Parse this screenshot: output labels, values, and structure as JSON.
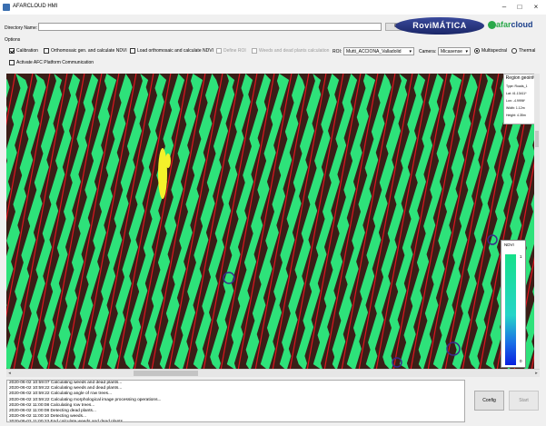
{
  "window": {
    "title": "AFARCLOUD HMI",
    "minimize_icon": "minimize-icon",
    "maximize_icon": "maximize-icon",
    "close_icon": "close-icon"
  },
  "directory": {
    "label": "Directory Name:",
    "value": "",
    "open_label": "Open"
  },
  "logos": {
    "rovimatica": "RoviMÁTICA",
    "afarcloud_prefix": "afar",
    "afarcloud_suffix": "cloud"
  },
  "options": {
    "label": "Options",
    "calibration": {
      "label": "Calibration",
      "checked": true
    },
    "orthomosaic_ndvi": {
      "label": "Orthomosaic gen. and calculate NDVI",
      "checked": false
    },
    "load_orthomosaic": {
      "label": "Load orthomosaic and calculate NDVI",
      "checked": false
    },
    "define_roi": {
      "label": "Define ROI",
      "checked": false,
      "disabled": true
    },
    "weeds_dead": {
      "label": "Weeds and dead plants calculation",
      "checked": false,
      "disabled": true
    },
    "roi_label": "ROI:",
    "roi_value": "Mutti_ACCIONA_Valladolid",
    "camera_label": "Camera:",
    "camera_value": "Micasense",
    "multispectral": {
      "label": "Multispectral",
      "selected": true
    },
    "thermal": {
      "label": "Thermal",
      "selected": false
    },
    "activate_afc": {
      "label": "Activate AFC Platform Communication",
      "checked": false
    }
  },
  "geoinfo": {
    "title": "Region geoinfo",
    "type": "Type: Roads_1",
    "lat": "Lat: 41.13411º",
    "lon": "Lon: -4.9996º",
    "width": "Width: 1.12m",
    "height": "Height: 4.35m"
  },
  "ndvi_legend": {
    "title": "NDVI",
    "max": "1",
    "min": "0",
    "colors": {
      "high": "#16e08a",
      "mid": "#25d4c8",
      "low": "#0a1fe0"
    }
  },
  "field_colors": {
    "soil": "#3a1e17",
    "crop": "#2ee27a",
    "row_line": "#e0151f",
    "weed": "#f4f12a",
    "dead": "#3a2a8a"
  },
  "log": {
    "lines": [
      "2020-06-02 10:59:07 Calculating weeds and dead plants...",
      "2020-06-02 10:59:22 Calculating weeds and dead plants...",
      "2020-06-02 10:59:22 Calculating angle of row trees...",
      "2020-06-02 10:59:22 Calculating morphological image processing operations...",
      "2020-06-02 11:00:08 Calculating row trees...",
      "2020-06-02 11:00:08 Detecting dead plants...",
      "2020-06-02 11:00:10 Detecting weeds...",
      "2020-06-02 11:00:23 End calculate weeds and dead plants..."
    ]
  },
  "buttons": {
    "config": "Config",
    "start": "Start"
  }
}
